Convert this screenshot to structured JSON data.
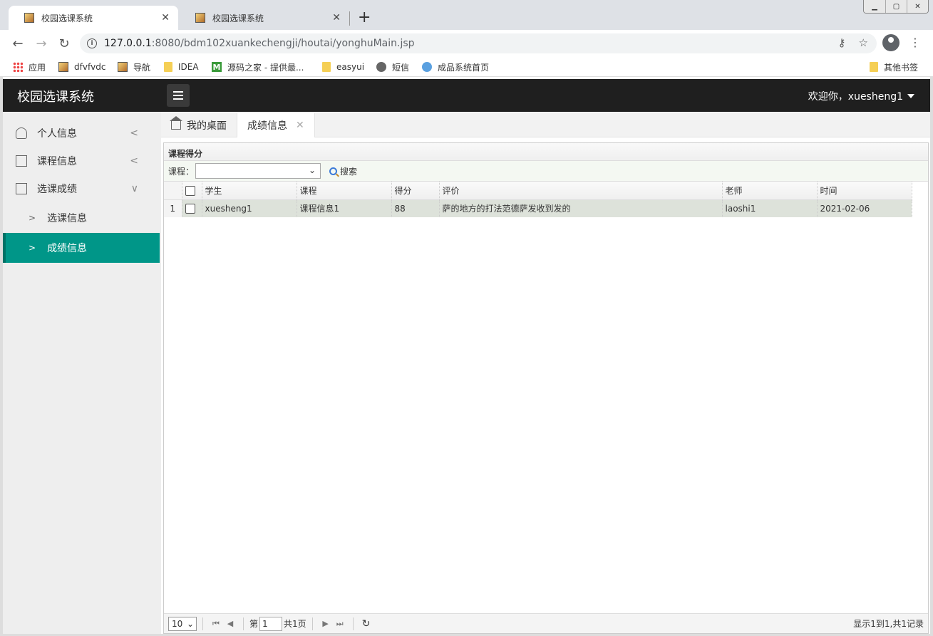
{
  "browser": {
    "tabs": [
      {
        "title": "校园选课系统",
        "active": true
      },
      {
        "title": "校园选课系统",
        "active": false
      }
    ],
    "url_host": "127.0.0.1",
    "url_rest": ":8080/bdm102xuankechengji/houtai/yonghuMain.jsp",
    "bookmarks": [
      {
        "label": "应用",
        "icon": "apps-icon"
      },
      {
        "label": "dfvfvdc",
        "icon": "image-icon"
      },
      {
        "label": "导航",
        "icon": "image-icon"
      },
      {
        "label": "IDEA",
        "icon": "folder-icon"
      },
      {
        "label": "源码之家 - 提供最...",
        "icon": "m-logo-icon"
      },
      {
        "label": "easyui",
        "icon": "folder-icon"
      },
      {
        "label": "短信",
        "icon": "globe-icon"
      },
      {
        "label": "成品系统首页",
        "icon": "home-icon"
      }
    ],
    "other_bookmarks": "其他书签"
  },
  "app": {
    "title": "校园选课系统",
    "welcome": "欢迎你，xuesheng1"
  },
  "sidebar": {
    "items": [
      {
        "label": "个人信息",
        "icon": "user-icon",
        "arrow": "<"
      },
      {
        "label": "课程信息",
        "icon": "document-icon",
        "arrow": "<"
      },
      {
        "label": "选课成绩",
        "icon": "document-icon",
        "arrow": "∨"
      }
    ],
    "subitems": [
      {
        "label": "选课信息",
        "active": false
      },
      {
        "label": "成绩信息",
        "active": true
      }
    ]
  },
  "page_tabs": {
    "home": "我的桌面",
    "current": "成绩信息"
  },
  "panel": {
    "title": "课程得分",
    "filter_label": "课程：",
    "search_label": "搜索",
    "columns": [
      "学生",
      "课程",
      "得分",
      "评价",
      "老师",
      "时间"
    ],
    "rows": [
      {
        "rownum": "1",
        "cells": [
          "xuesheng1",
          "课程信息1",
          "88",
          "萨的地方的打法范德萨发收到发的",
          "laoshi1",
          "2021-02-06"
        ]
      }
    ]
  },
  "pager": {
    "page_size": "10",
    "page_prefix": "第",
    "page_value": "1",
    "page_total": "共1页",
    "info": "显示1到1,共1记录"
  }
}
